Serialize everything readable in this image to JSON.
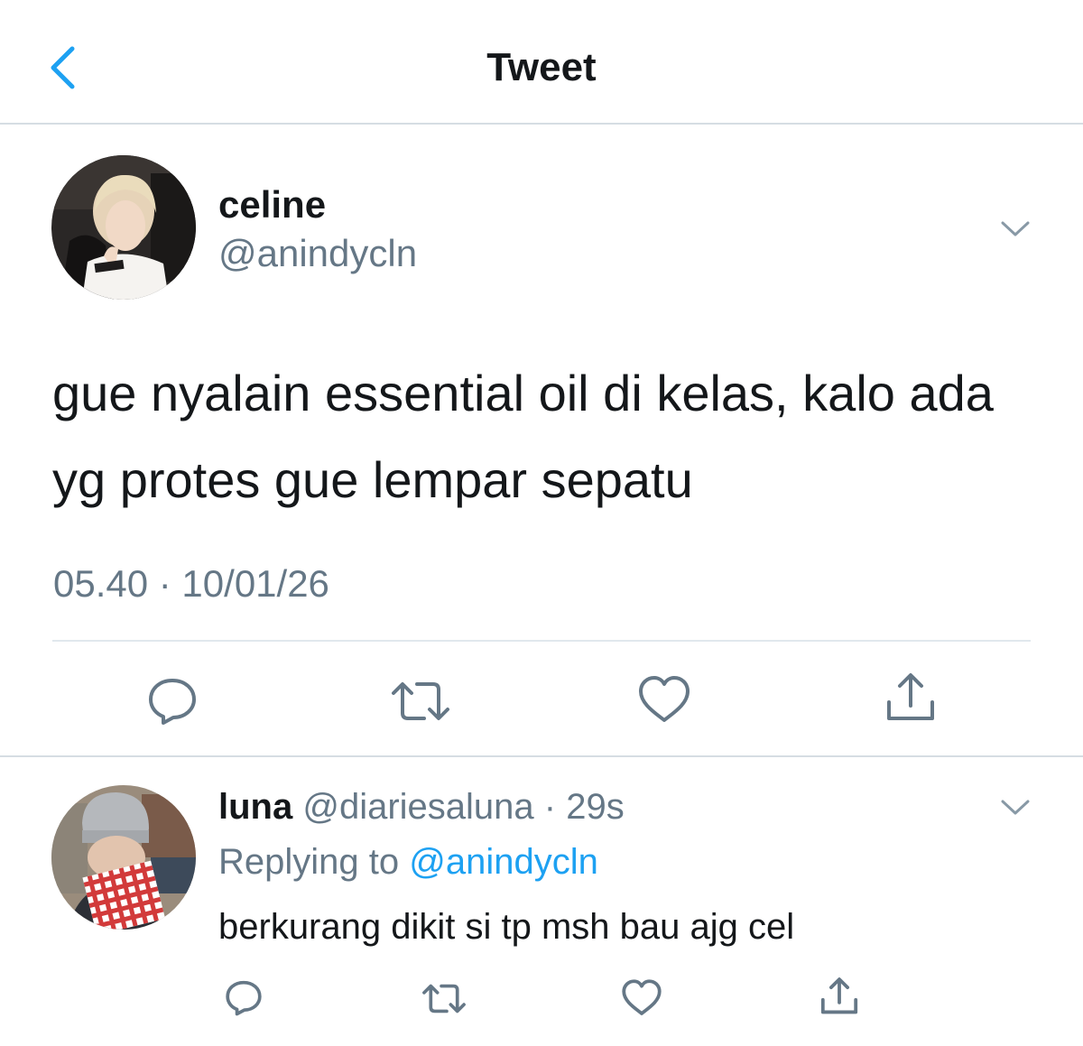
{
  "header": {
    "title": "Tweet",
    "back_icon": "chevron-left-icon",
    "accent_color": "#1da1f2"
  },
  "tweet": {
    "author_name": "celine",
    "author_handle": "@anindycln",
    "text": "gue nyalain essential oil di kelas, kalo ada yg protes gue lempar sepatu",
    "timestamp": "05.40 · 10/01/26",
    "actions": [
      "reply-icon",
      "retweet-icon",
      "like-icon",
      "share-icon"
    ]
  },
  "reply": {
    "author_name": "luna",
    "author_handle": "@diariesaluna",
    "separator": " · ",
    "time": "29s",
    "replying_prefix": "Replying to ",
    "replying_to": "@anindycln",
    "text": "berkurang dikit si tp msh bau ajg cel",
    "actions": [
      "reply-icon",
      "retweet-icon",
      "like-icon",
      "share-icon"
    ]
  }
}
